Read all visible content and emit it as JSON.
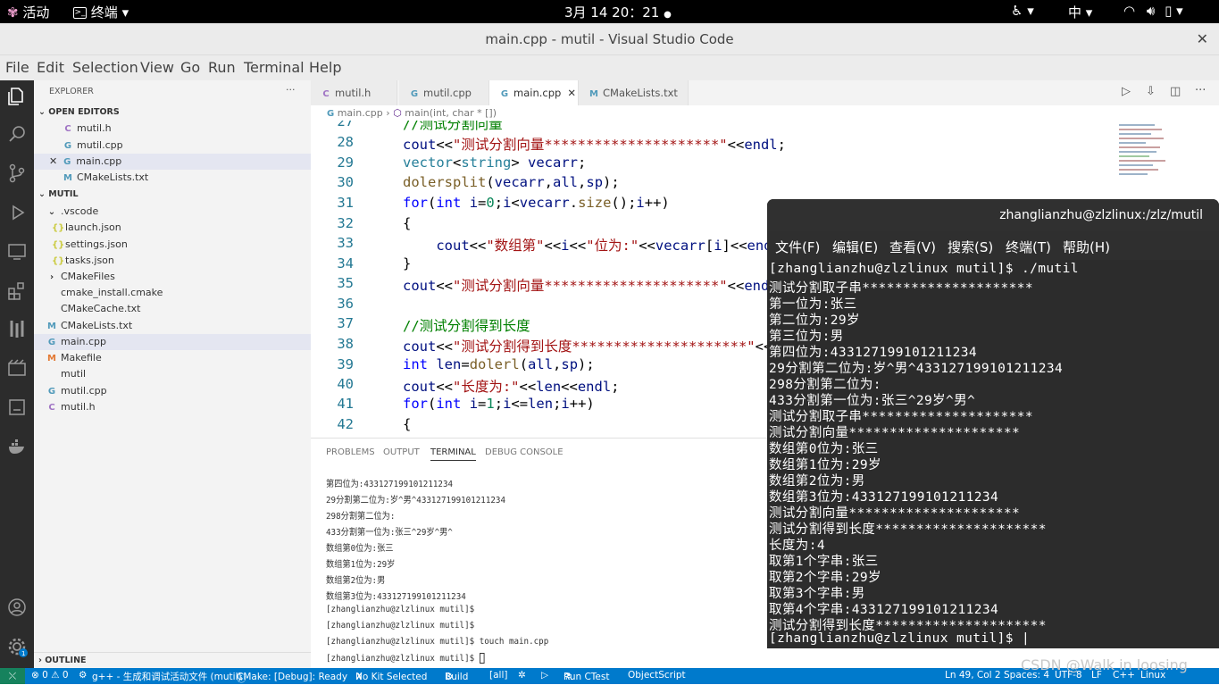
{
  "topbar": {
    "activities": "活动",
    "app": "终端",
    "clock": "3月 14  20：21",
    "input_method": "中"
  },
  "window": {
    "title": "main.cpp - mutil - Visual Studio Code",
    "close": "✕"
  },
  "menu": [
    "File",
    "Edit",
    "Selection",
    "View",
    "Go",
    "Run",
    "Terminal",
    "Help"
  ],
  "sidebar": {
    "explorer_title": "EXPLORER",
    "more": "···",
    "open_editors_title": "OPEN EDITORS",
    "open_editors": [
      {
        "icon": "C",
        "name": "mutil.h"
      },
      {
        "icon": "G",
        "name": "mutil.cpp"
      },
      {
        "icon": "G",
        "name": "main.cpp"
      },
      {
        "icon": "M",
        "name": "CMakeLists.txt"
      }
    ],
    "folder_title": "MUTIL",
    "tree": [
      {
        "icon": "›",
        "name": ".vscode"
      },
      {
        "icon": "{}",
        "name": "launch.json"
      },
      {
        "icon": "{}",
        "name": "settings.json"
      },
      {
        "icon": "{}",
        "name": "tasks.json"
      },
      {
        "icon": "›",
        "name": "CMakeFiles"
      },
      {
        "icon": "",
        "name": "cmake_install.cmake"
      },
      {
        "icon": "",
        "name": "CMakeCache.txt"
      },
      {
        "icon": "M",
        "name": "CMakeLists.txt"
      },
      {
        "icon": "G",
        "name": "main.cpp"
      },
      {
        "icon": "M",
        "name": "Makefile"
      },
      {
        "icon": "",
        "name": "mutil"
      },
      {
        "icon": "G",
        "name": "mutil.cpp"
      },
      {
        "icon": "C",
        "name": "mutil.h"
      }
    ],
    "outline_title": "OUTLINE"
  },
  "tabs": [
    {
      "icon": "C",
      "label": "mutil.h"
    },
    {
      "icon": "G",
      "label": "mutil.cpp"
    },
    {
      "icon": "G",
      "label": "main.cpp"
    },
    {
      "icon": "M",
      "label": "CMakeLists.txt"
    }
  ],
  "breadcrumb": {
    "file": "main.cpp",
    "symbol": "main(int, char * [])"
  },
  "editor": {
    "line_numbers": [
      "27",
      "28",
      "29",
      "30",
      "31",
      "32",
      "33",
      "34",
      "35",
      "36",
      "37",
      "38",
      "39",
      "40",
      "41",
      "42"
    ],
    "line27": "//测试分割向量",
    "line37": "//测试分割得到长度"
  },
  "panel": {
    "tabs": [
      "PROBLEMS",
      "OUTPUT",
      "TERMINAL",
      "DEBUG CONSOLE"
    ],
    "lines": [
      "第四位为:433127199101211234",
      "29分割第二位为:岁^男^433127199101211234",
      "298分割第二位为:",
      "433分割第一位为:张三^29岁^男^",
      "数组第0位为:张三",
      "数组第1位为:29岁",
      "数组第2位为:男",
      "数组第3位为:433127199101211234",
      "[zhanglianzhu@zlzlinux mutil]$",
      "[zhanglianzhu@zlzlinux mutil]$",
      "[zhanglianzhu@zlzlinux mutil]$ touch main.cpp",
      "[zhanglianzhu@zlzlinux mutil]$ "
    ]
  },
  "statusbar": {
    "problems": "⊗ 0 ⚠ 0",
    "task": "g++ - 生成和调试活动文件 (mutil)",
    "cmake": "CMake: [Debug]: Ready",
    "kit": "No Kit Selected",
    "build": "Build",
    "all": "[all]",
    "ctest": "Run CTest",
    "objectscript": "ObjectScript",
    "position": "Ln 49, Col 2",
    "spaces": "Spaces: 4",
    "encoding": "UTF-8",
    "eol": "LF",
    "language": "C++",
    "os": "Linux"
  },
  "terminal": {
    "title": "zhanglianzhu@zlzlinux:/zlz/mutil",
    "menu": [
      "文件(F)",
      "编辑(E)",
      "查看(V)",
      "搜索(S)",
      "终端(T)",
      "帮助(H)"
    ],
    "lines": [
      "[zhanglianzhu@zlzlinux mutil]$ ./mutil",
      "测试分割取子串*********************",
      "第一位为:张三",
      "第二位为:29岁",
      "第三位为:男",
      "第四位为:433127199101211234",
      "29分割第二位为:岁^男^433127199101211234",
      "298分割第二位为:",
      "433分割第一位为:张三^29岁^男^",
      "测试分割取子串*********************",
      "测试分割向量*********************",
      "数组第0位为:张三",
      "数组第1位为:29岁",
      "数组第2位为:男",
      "数组第3位为:433127199101211234",
      "测试分割向量*********************",
      "测试分割得到长度*********************",
      "长度为:4",
      "取第1个字串:张三",
      "取第2个字串:29岁",
      "取第3个字串:男",
      "取第4个字串:433127199101211234",
      "测试分割得到长度*********************",
      "[zhanglianzhu@zlzlinux mutil]$ |"
    ]
  },
  "watermark": "CSDN @Walk in loosing",
  "colors": {
    "statusbar": "#007acc",
    "activitybar": "#2c2c2c",
    "terminal_bg": "#2c2c2c"
  }
}
